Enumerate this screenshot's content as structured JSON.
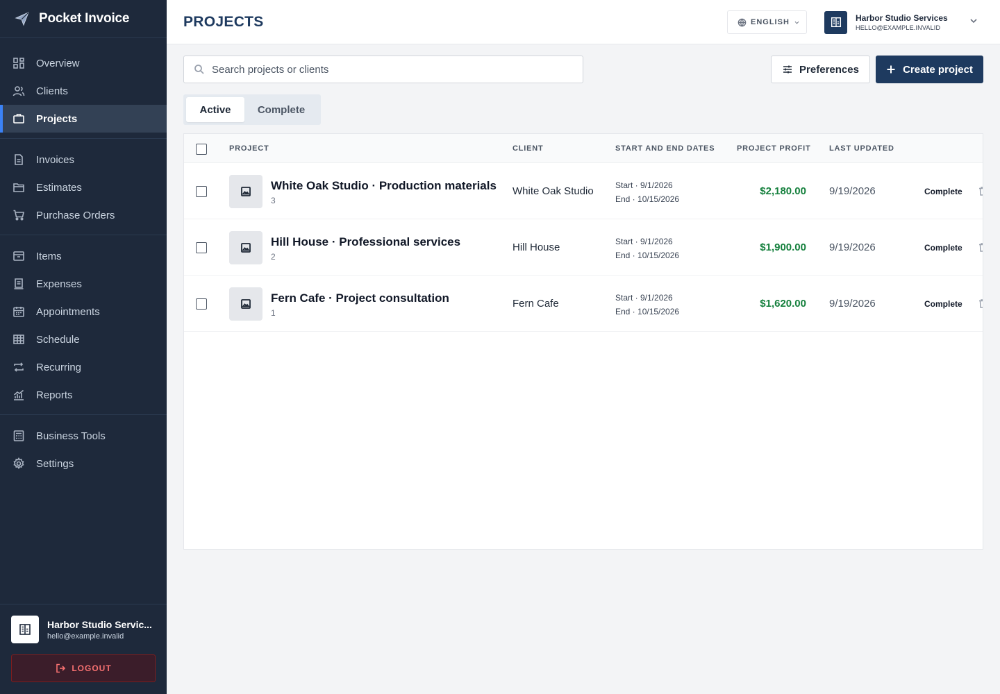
{
  "app": {
    "name": "Pocket Invoice",
    "logo_icon": "paper-plane-icon"
  },
  "nav": {
    "group1": [
      {
        "label": "Overview",
        "icon": "grid-icon"
      },
      {
        "label": "Clients",
        "icon": "users-icon"
      },
      {
        "label": "Projects",
        "icon": "briefcase-icon",
        "active": true
      }
    ],
    "group2": [
      {
        "label": "Invoices",
        "icon": "document-icon"
      },
      {
        "label": "Estimates",
        "icon": "folder-icon"
      },
      {
        "label": "Purchase Orders",
        "icon": "cart-icon"
      }
    ],
    "group3": [
      {
        "label": "Items",
        "icon": "archive-icon"
      },
      {
        "label": "Expenses",
        "icon": "receipt-icon"
      },
      {
        "label": "Appointments",
        "icon": "calendar-icon"
      },
      {
        "label": "Schedule",
        "icon": "table-icon"
      },
      {
        "label": "Recurring",
        "icon": "repeat-icon"
      },
      {
        "label": "Reports",
        "icon": "chart-icon"
      }
    ],
    "group4": [
      {
        "label": "Business Tools",
        "icon": "calculator-icon"
      },
      {
        "label": "Settings",
        "icon": "gear-icon"
      }
    ]
  },
  "sidebar_user": {
    "name": "Harbor Studio Services",
    "name_display": "Harbor Studio Servic...",
    "email": "hello@example.invalid",
    "logout_label": "LOGOUT"
  },
  "header": {
    "title": "PROJECTS",
    "language": "ENGLISH",
    "account_name": "Harbor Studio Services",
    "account_email": "HELLO@EXAMPLE.INVALID"
  },
  "toolbar": {
    "search_placeholder": "Search projects or clients",
    "preferences_label": "Preferences",
    "create_label": "Create project"
  },
  "tabs": [
    {
      "label": "Active",
      "selected": true
    },
    {
      "label": "Complete",
      "selected": false
    }
  ],
  "table": {
    "columns": [
      "PROJECT",
      "CLIENT",
      "START AND END DATES",
      "PROJECT PROFIT",
      "LAST UPDATED"
    ],
    "rows": [
      {
        "name": "White Oak Studio · Production materials",
        "count": "3",
        "client": "White Oak Studio",
        "start": "Start · 9/1/2026",
        "end": "End · 10/15/2026",
        "profit": "$2,180.00",
        "updated": "9/19/2026",
        "action": "Complete"
      },
      {
        "name": "Hill House · Professional services",
        "count": "2",
        "client": "Hill House",
        "start": "Start · 9/1/2026",
        "end": "End · 10/15/2026",
        "profit": "$1,900.00",
        "updated": "9/19/2026",
        "action": "Complete"
      },
      {
        "name": "Fern Cafe · Project consultation",
        "count": "1",
        "client": "Fern Cafe",
        "start": "Start · 9/1/2026",
        "end": "End · 10/15/2026",
        "profit": "$1,620.00",
        "updated": "9/19/2026",
        "action": "Complete"
      }
    ]
  },
  "colors": {
    "sidebar_bg": "#1e293b",
    "primary": "#1e3a5f",
    "profit_green": "#15803d",
    "logout_red": "#f87171"
  }
}
